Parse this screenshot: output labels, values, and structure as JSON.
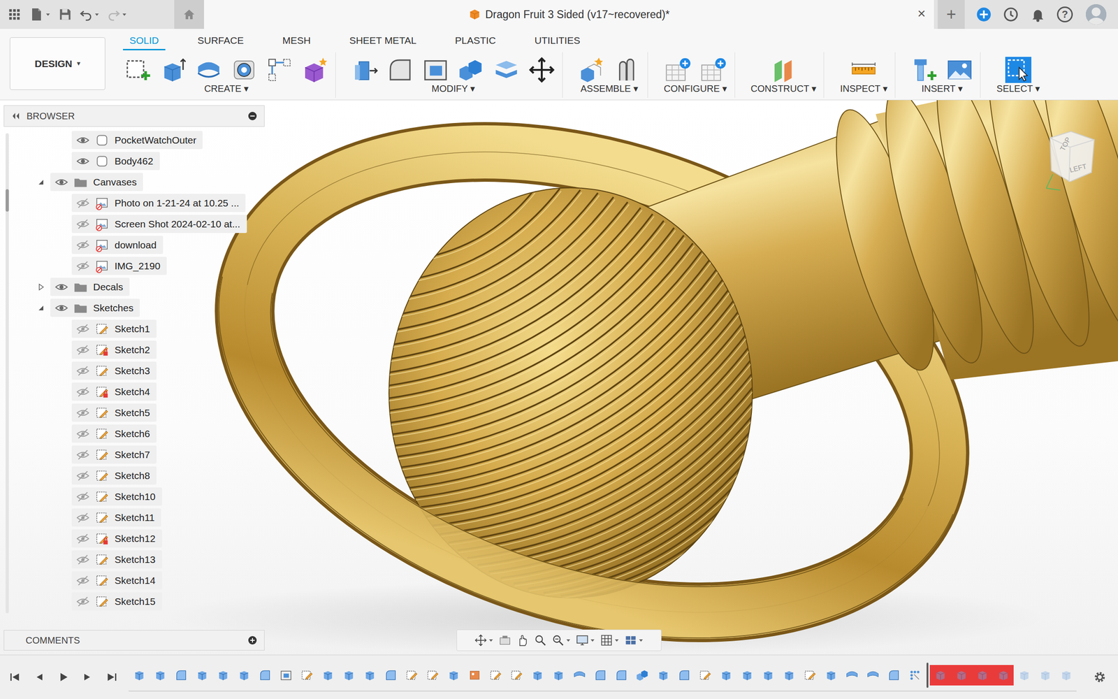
{
  "window": {
    "title": "Dragon Fruit 3 Sided (v17~recovered)*",
    "close": "×",
    "new_tab": "+",
    "help": "?"
  },
  "history": {
    "undo_enabled": true,
    "redo_enabled": false
  },
  "workspace": {
    "label": "DESIGN",
    "caret": "▾"
  },
  "tabs": [
    {
      "label": "SOLID",
      "selected": true
    },
    {
      "label": "SURFACE",
      "selected": false
    },
    {
      "label": "MESH",
      "selected": false
    },
    {
      "label": "SHEET METAL",
      "selected": false
    },
    {
      "label": "PLASTIC",
      "selected": false
    },
    {
      "label": "UTILITIES",
      "selected": false
    }
  ],
  "tool_groups": [
    {
      "label": "CREATE ▾"
    },
    {
      "label": "MODIFY ▾"
    },
    {
      "label": "ASSEMBLE ▾"
    },
    {
      "label": "CONFIGURE ▾"
    },
    {
      "label": "CONSTRUCT ▾"
    },
    {
      "label": "INSPECT ▾"
    },
    {
      "label": "INSERT ▾"
    },
    {
      "label": "SELECT ▾"
    }
  ],
  "browser": {
    "title": "BROWSER",
    "items": [
      {
        "label": "PocketWatchOuter",
        "kind": "body",
        "depth": 2,
        "visible": true,
        "alert": false
      },
      {
        "label": "Body462",
        "kind": "body",
        "depth": 2,
        "visible": true,
        "alert": false
      },
      {
        "label": "Canvases",
        "kind": "folder",
        "depth": 1,
        "visible": true,
        "alert": false,
        "expanded": true
      },
      {
        "label": "Photo on 1-21-24 at 10.25 ...",
        "kind": "canvas",
        "depth": 2,
        "visible": false,
        "alert": false
      },
      {
        "label": "Screen Shot 2024-02-10 at...",
        "kind": "canvas",
        "depth": 2,
        "visible": false,
        "alert": false
      },
      {
        "label": "download",
        "kind": "canvas",
        "depth": 2,
        "visible": false,
        "alert": false
      },
      {
        "label": "IMG_2190",
        "kind": "canvas",
        "depth": 2,
        "visible": false,
        "alert": false
      },
      {
        "label": "Decals",
        "kind": "folder",
        "depth": 1,
        "visible": true,
        "alert": false,
        "expanded": false
      },
      {
        "label": "Sketches",
        "kind": "folder",
        "depth": 1,
        "visible": true,
        "alert": false,
        "expanded": true
      },
      {
        "label": "Sketch1",
        "kind": "sketch",
        "depth": 2,
        "visible": false,
        "alert": false
      },
      {
        "label": "Sketch2",
        "kind": "sketch",
        "depth": 2,
        "visible": false,
        "alert": true
      },
      {
        "label": "Sketch3",
        "kind": "sketch",
        "depth": 2,
        "visible": false,
        "alert": false
      },
      {
        "label": "Sketch4",
        "kind": "sketch",
        "depth": 2,
        "visible": false,
        "alert": true
      },
      {
        "label": "Sketch5",
        "kind": "sketch",
        "depth": 2,
        "visible": false,
        "alert": false
      },
      {
        "label": "Sketch6",
        "kind": "sketch",
        "depth": 2,
        "visible": false,
        "alert": false
      },
      {
        "label": "Sketch7",
        "kind": "sketch",
        "depth": 2,
        "visible": false,
        "alert": false
      },
      {
        "label": "Sketch8",
        "kind": "sketch",
        "depth": 2,
        "visible": false,
        "alert": false
      },
      {
        "label": "Sketch10",
        "kind": "sketch",
        "depth": 2,
        "visible": false,
        "alert": false
      },
      {
        "label": "Sketch11",
        "kind": "sketch",
        "depth": 2,
        "visible": false,
        "alert": false
      },
      {
        "label": "Sketch12",
        "kind": "sketch",
        "depth": 2,
        "visible": false,
        "alert": true
      },
      {
        "label": "Sketch13",
        "kind": "sketch",
        "depth": 2,
        "visible": false,
        "alert": false
      },
      {
        "label": "Sketch14",
        "kind": "sketch",
        "depth": 2,
        "visible": false,
        "alert": false
      },
      {
        "label": "Sketch15",
        "kind": "sketch",
        "depth": 2,
        "visible": false,
        "alert": false
      }
    ]
  },
  "viewcube": {
    "top": "TOP",
    "left": "LEFT"
  },
  "comments": {
    "label": "COMMENTS"
  },
  "timeline": {
    "steps": [
      {
        "kind": "box",
        "error": false,
        "past_marker": false
      },
      {
        "kind": "box",
        "error": false,
        "past_marker": false
      },
      {
        "kind": "fillet",
        "error": false,
        "past_marker": false
      },
      {
        "kind": "box",
        "error": false,
        "past_marker": false
      },
      {
        "kind": "box",
        "error": false,
        "past_marker": false
      },
      {
        "kind": "box",
        "error": false,
        "past_marker": false
      },
      {
        "kind": "fillet",
        "error": false,
        "past_marker": false
      },
      {
        "kind": "shell",
        "error": false,
        "past_marker": false
      },
      {
        "kind": "sketch",
        "error": false,
        "past_marker": false
      },
      {
        "kind": "box",
        "error": false,
        "past_marker": false
      },
      {
        "kind": "box",
        "error": false,
        "past_marker": false
      },
      {
        "kind": "box",
        "error": false,
        "past_marker": false
      },
      {
        "kind": "fillet",
        "error": false,
        "past_marker": false
      },
      {
        "kind": "sketch",
        "error": false,
        "past_marker": false
      },
      {
        "kind": "sketch",
        "error": false,
        "past_marker": false
      },
      {
        "kind": "box",
        "error": false,
        "past_marker": false
      },
      {
        "kind": "decal",
        "error": false,
        "past_marker": false
      },
      {
        "kind": "sketch",
        "error": false,
        "past_marker": false
      },
      {
        "kind": "sketch",
        "error": false,
        "past_marker": false
      },
      {
        "kind": "box",
        "error": false,
        "past_marker": false
      },
      {
        "kind": "box",
        "error": false,
        "past_marker": false
      },
      {
        "kind": "revolve",
        "error": false,
        "past_marker": false
      },
      {
        "kind": "fillet",
        "error": false,
        "past_marker": false
      },
      {
        "kind": "fillet",
        "error": false,
        "past_marker": false
      },
      {
        "kind": "combine",
        "error": false,
        "past_marker": false
      },
      {
        "kind": "box",
        "error": false,
        "past_marker": false
      },
      {
        "kind": "fillet",
        "error": false,
        "past_marker": false
      },
      {
        "kind": "sketch",
        "error": false,
        "past_marker": false
      },
      {
        "kind": "box",
        "error": false,
        "past_marker": false
      },
      {
        "kind": "box",
        "error": false,
        "past_marker": false
      },
      {
        "kind": "box",
        "error": false,
        "past_marker": false
      },
      {
        "kind": "box",
        "error": false,
        "past_marker": false
      },
      {
        "kind": "sketch",
        "error": false,
        "past_marker": false
      },
      {
        "kind": "box",
        "error": false,
        "past_marker": false
      },
      {
        "kind": "revolve",
        "error": false,
        "past_marker": false
      },
      {
        "kind": "revolve",
        "error": false,
        "past_marker": false
      },
      {
        "kind": "fillet",
        "error": false,
        "past_marker": false
      },
      {
        "kind": "pattern",
        "error": false,
        "past_marker": false
      },
      {
        "kind": "box",
        "error": true,
        "past_marker": true
      },
      {
        "kind": "box",
        "error": true,
        "past_marker": true
      },
      {
        "kind": "box",
        "error": true,
        "past_marker": true
      },
      {
        "kind": "box",
        "error": true,
        "past_marker": true
      },
      {
        "kind": "box",
        "error": false,
        "past_marker": true
      },
      {
        "kind": "box",
        "error": false,
        "past_marker": true
      },
      {
        "kind": "box",
        "error": false,
        "past_marker": true
      }
    ]
  }
}
